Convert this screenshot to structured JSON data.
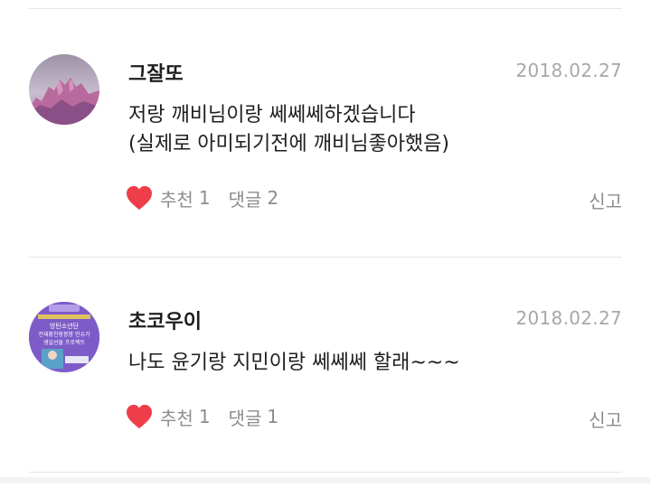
{
  "comments": [
    {
      "author": "그잘또",
      "date": "2018.02.27",
      "lines": [
        "저랑 깨비님이랑 쎄쎄쎄하겠습니다",
        "(실제로 아미되기전에 깨비님좋아했음)"
      ],
      "like_label": "추천",
      "like_count": "1",
      "reply_label": "댓글",
      "reply_count": "2",
      "report_label": "신고"
    },
    {
      "author": "초코우이",
      "date": "2018.02.27",
      "lines": [
        "나도 윤기랑 지민이랑 쎄쎄쎄 할래~~~"
      ],
      "like_label": "추천",
      "like_count": "1",
      "reply_label": "댓글",
      "reply_count": "1",
      "report_label": "신고"
    }
  ],
  "avatar2_text": [
    "방탄소년단",
    "전재황찬팡붕붕 민슈가",
    "생일선물 프로젝트"
  ],
  "colors": {
    "heart": "#ef3d4a",
    "date": "#a8a8a8",
    "meta": "#8c8c8c",
    "avatar2_bg": "#7d5cc8"
  }
}
